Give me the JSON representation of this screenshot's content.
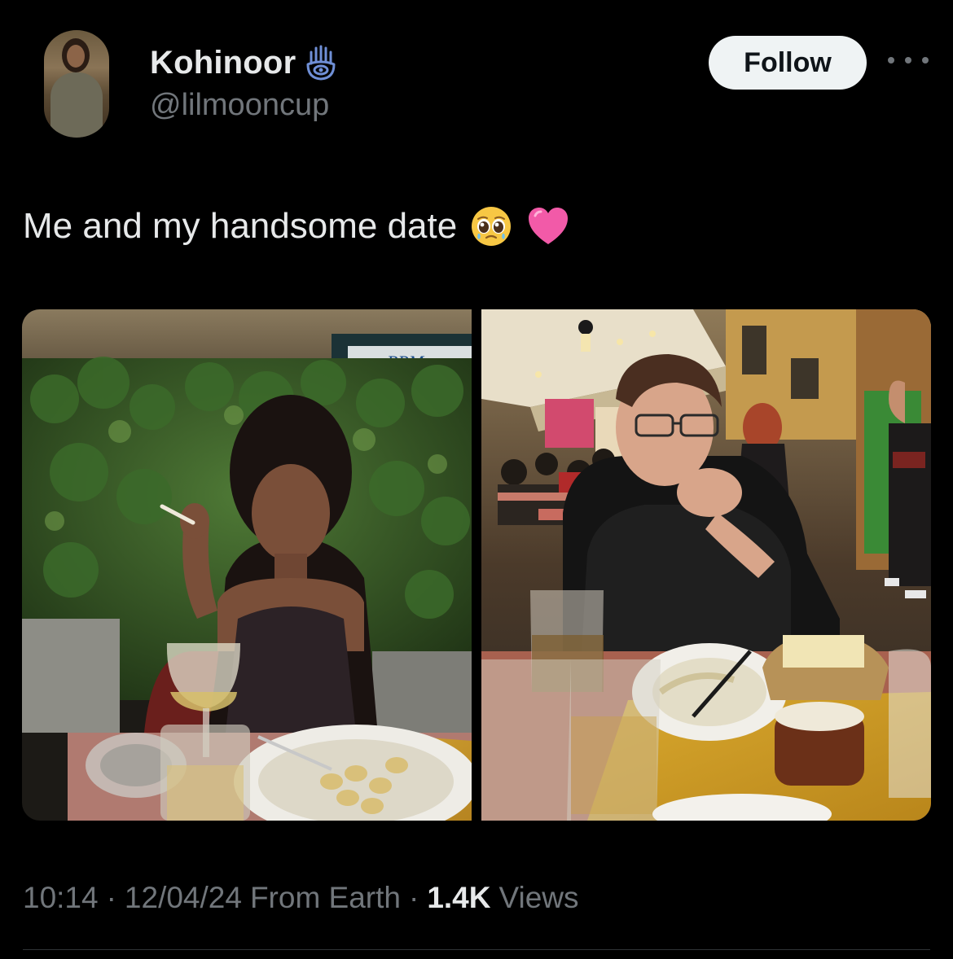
{
  "author": {
    "display_name": "Kohinoor",
    "handle": "@lilmooncup",
    "badge_icon": "hamsa-hand-icon",
    "avatar_alt": "profile photo"
  },
  "actions": {
    "follow_label": "Follow",
    "more_icon": "more-options-icon"
  },
  "tweet": {
    "text": "Me and my handsome date",
    "emojis": [
      "pleading-face-emoji",
      "pink-heart-emoji"
    ]
  },
  "media": {
    "photos": [
      {
        "icon": "photo-woman-at-table",
        "sign_text": "BPM"
      },
      {
        "icon": "photo-man-at-table"
      }
    ]
  },
  "meta": {
    "time": "10:14",
    "date": "12/04/24",
    "location": "From Earth",
    "views_count": "1.4K",
    "views_label": "Views",
    "separator": "·"
  },
  "colors": {
    "background": "#000000",
    "primary_text": "#e7e9ea",
    "secondary_text": "#71767b",
    "follow_bg": "#eff3f4",
    "divider": "#2f3336",
    "badge_blue": "#6f8fd6"
  }
}
